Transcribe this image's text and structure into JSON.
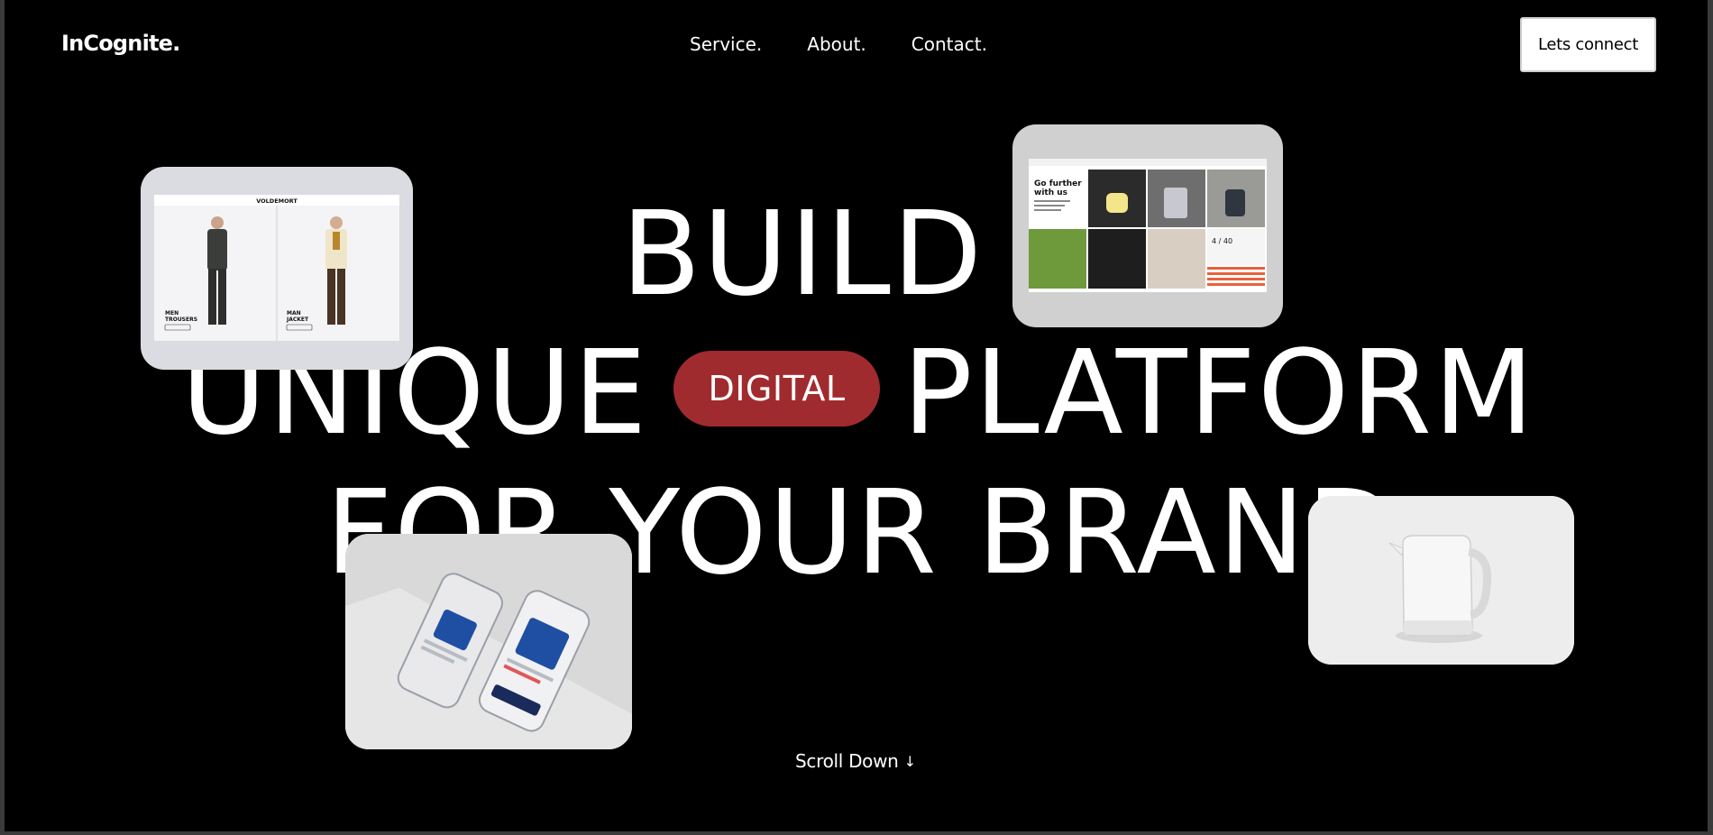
{
  "header": {
    "logo": "InCognite.",
    "nav": [
      "Service.",
      "About.",
      "Contact."
    ],
    "cta": "Lets connect"
  },
  "hero": {
    "line1": "BUILD",
    "line2_start": "UNIQUE",
    "pill": "DIGITAL",
    "line2_end": "PLATFORM",
    "line3": "FOR YOUR BRAND"
  },
  "cards": {
    "men": {
      "brand": "VOLDEMORT",
      "left_caption_1": "MEN",
      "left_caption_2": "TROUSERS",
      "right_caption_1": "MAN",
      "right_caption_2": "JACKET"
    },
    "shop": {
      "headline_1": "Go further",
      "headline_2": "with us",
      "counter": "4 / 40"
    }
  },
  "scroll": {
    "label": "Scroll Down",
    "arrow": "↓"
  },
  "colors": {
    "background": "#000000",
    "accent": "#a02b2e",
    "text": "#ffffff"
  }
}
